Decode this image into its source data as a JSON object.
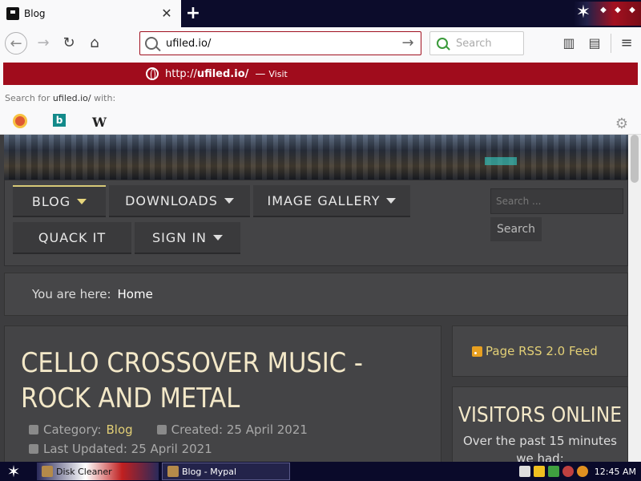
{
  "browser": {
    "tab": {
      "title": "Blog"
    },
    "urlbar": {
      "value": "ufiled.io/"
    },
    "searchbar": {
      "placeholder": "Search"
    },
    "dropdown": {
      "url_prefix": "http://",
      "url_host": "ufiled.io/",
      "separator": "—",
      "action": "Visit",
      "search_for_prefix": "Search for",
      "search_for_term": "ufiled.io/",
      "search_for_suffix": "with:",
      "engines": [
        "duckduckgo-icon",
        "bing-icon",
        "wikipedia-icon"
      ],
      "wiki_glyph": "W",
      "bing_glyph": "b"
    }
  },
  "site": {
    "menu": [
      {
        "label": "BLOG",
        "has_dropdown": true,
        "active": true
      },
      {
        "label": "DOWNLOADS",
        "has_dropdown": true
      },
      {
        "label": "IMAGE GALLERY",
        "has_dropdown": true
      },
      {
        "label": "QUACK IT",
        "has_dropdown": false
      },
      {
        "label": "SIGN IN",
        "has_dropdown": true
      }
    ],
    "search": {
      "placeholder": "Search ...",
      "button": "Search"
    },
    "breadcrumb": {
      "label": "You are here:",
      "current": "Home"
    },
    "article": {
      "title": "CELLO CROSSOVER MUSIC - ROCK AND METAL",
      "category_label": "Category:",
      "category_value": "Blog",
      "created": "Created: 25 April 2021",
      "updated": "Last Updated: 25 April 2021"
    },
    "rss": {
      "label": "Page RSS 2.0 Feed"
    },
    "visitors": {
      "title": "VISITORS ONLINE",
      "line1": "Over the past 15 minutes",
      "line2": "we had:"
    }
  },
  "taskbar": {
    "items": [
      {
        "label": "Disk Cleaner"
      },
      {
        "label": "Blog - Mypal"
      }
    ],
    "clock": "12:45 AM"
  },
  "colors": {
    "accent_red": "#a00c1c",
    "gold_text": "#e2cf76",
    "title_text": "#f3e8c8",
    "page_bg": "#3d3d3f"
  }
}
